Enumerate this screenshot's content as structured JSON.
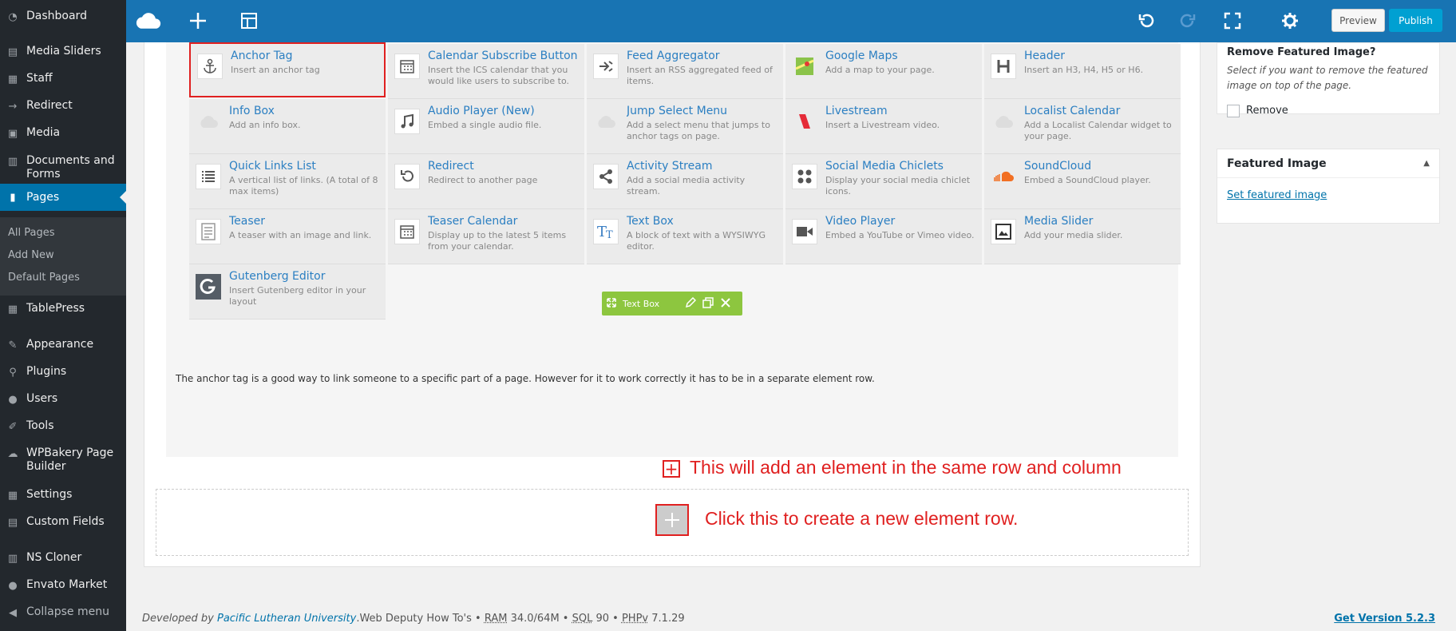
{
  "sidebar": {
    "items": [
      {
        "label": "Dashboard",
        "icon": "dashboard-icon"
      },
      {
        "label": "Media Sliders",
        "icon": "sliders-icon"
      },
      {
        "label": "Staff",
        "icon": "staff-icon"
      },
      {
        "label": "Redirect",
        "icon": "redirect-arrow-icon"
      },
      {
        "label": "Media",
        "icon": "media-icon"
      },
      {
        "label": "Documents and Forms",
        "icon": "documents-icon"
      },
      {
        "label": "Pages",
        "icon": "pages-icon"
      },
      {
        "label": "TablePress",
        "icon": "tablepress-icon"
      },
      {
        "label": "Appearance",
        "icon": "appearance-brush-icon"
      },
      {
        "label": "Plugins",
        "icon": "plugins-icon"
      },
      {
        "label": "Users",
        "icon": "users-icon"
      },
      {
        "label": "Tools",
        "icon": "tools-wrench-icon"
      },
      {
        "label": "WPBakery Page Builder",
        "icon": "wpbakery-cloud-icon"
      },
      {
        "label": "Settings",
        "icon": "settings-icon"
      },
      {
        "label": "Custom Fields",
        "icon": "custom-fields-icon"
      },
      {
        "label": "NS Cloner",
        "icon": "ns-cloner-icon"
      },
      {
        "label": "Envato Market",
        "icon": "envato-leaf-icon"
      },
      {
        "label": "Collapse menu",
        "icon": "collapse-circle-icon"
      }
    ],
    "submenu": [
      "All Pages",
      "Add New",
      "Default Pages"
    ]
  },
  "toolbar": {
    "preview": "Preview",
    "publish": "Publish"
  },
  "elements": [
    {
      "title": "Anchor Tag",
      "desc": "Insert an anchor tag",
      "icon": "anchor-icon",
      "selected": true
    },
    {
      "title": "Calendar Subscribe Button",
      "desc": "Insert the ICS calendar that you would like users to subscribe to.",
      "icon": "calendar-icon"
    },
    {
      "title": "Feed Aggregator",
      "desc": "Insert an RSS aggregated feed of items.",
      "icon": "feed-aggregator-icon"
    },
    {
      "title": "Google Maps",
      "desc": "Add a map to your page.",
      "icon": "google-maps-icon"
    },
    {
      "title": "Header",
      "desc": "Insert an H3, H4, H5 or H6.",
      "icon": "header-h-icon"
    },
    {
      "title": "Info Box",
      "desc": "Add an info box.",
      "icon": "cloud-icon"
    },
    {
      "title": "Audio Player (New)",
      "desc": "Embed a single audio file.",
      "icon": "music-note-icon"
    },
    {
      "title": "Jump Select Menu",
      "desc": "Add a select menu that jumps to anchor tags on page.",
      "icon": "cloud-icon"
    },
    {
      "title": "Livestream",
      "desc": "Insert a Livestream video.",
      "icon": "livestream-icon"
    },
    {
      "title": "Localist Calendar",
      "desc": "Add a Localist Calendar widget to your page.",
      "icon": "cloud-icon"
    },
    {
      "title": "Quick Links List",
      "desc": "A vertical list of links. (A total of 8 max items)",
      "icon": "list-icon"
    },
    {
      "title": "Redirect",
      "desc": "Redirect to another page",
      "icon": "redirect-icon"
    },
    {
      "title": "Activity Stream",
      "desc": "Add a social media activity stream.",
      "icon": "share-icon"
    },
    {
      "title": "Social Media Chiclets",
      "desc": "Display your social media chiclet icons.",
      "icon": "chiclets-icon"
    },
    {
      "title": "SoundCloud",
      "desc": "Embed a SoundCloud player.",
      "icon": "soundcloud-icon"
    },
    {
      "title": "Teaser",
      "desc": "A teaser with an image and link.",
      "icon": "teaser-icon"
    },
    {
      "title": "Teaser Calendar",
      "desc": "Display up to the latest 5 items from your calendar.",
      "icon": "calendar-icon"
    },
    {
      "title": "Text Box",
      "desc": "A block of text with a WYSIWYG editor.",
      "icon": "text-tt-icon"
    },
    {
      "title": "Video Player",
      "desc": "Embed a YouTube or Vimeo video.",
      "icon": "video-camera-icon"
    },
    {
      "title": "Media Slider",
      "desc": "Add your media slider.",
      "icon": "media-slider-icon"
    },
    {
      "title": "Gutenberg Editor",
      "desc": "Insert Gutenberg editor in your layout",
      "icon": "gutenberg-g-icon"
    }
  ],
  "textbox_toolbar": {
    "label": "Text Box"
  },
  "paragraph": "The anchor tag is a good way to link someone to a specific part of a page. However for it to work correctly it has to be in a separate element row.",
  "annotations": {
    "same_row": "This will add an element in the same row and column",
    "new_row": "Click this to create a new element row."
  },
  "right": {
    "remove_featured": {
      "title": "Remove Featured Image?",
      "desc": "Select if you want to remove the featured image on top of the page.",
      "checkbox": "Remove"
    },
    "featured": {
      "title": "Featured Image",
      "link": "Set featured image"
    }
  },
  "footer": {
    "developed": "Developed by ",
    "org": "Pacific Lutheran University",
    "rest": ".Web Deputy How To's • ",
    "ram_label": "RAM",
    "ram_val": "34.0/64M • ",
    "sql_label": "SQL",
    "sql_val": "90 • ",
    "php_label": "PHPv",
    "php_val": "7.1.29",
    "version": "Get Version 5.2.3"
  }
}
